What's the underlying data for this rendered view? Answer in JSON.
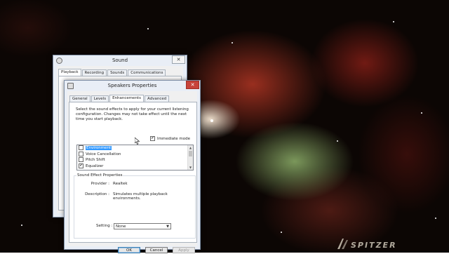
{
  "desktop": {
    "watermark": "SPITZER"
  },
  "sound_window": {
    "title": "Sound",
    "close_label": "✕",
    "tabs": [
      "Playback",
      "Recording",
      "Sounds",
      "Communications"
    ]
  },
  "speakers_window": {
    "title": "Speakers Properties",
    "close_label": "✕",
    "tabs": [
      "General",
      "Levels",
      "Enhancements",
      "Advanced"
    ],
    "active_tab": "Enhancements",
    "description": "Select the sound effects to apply for your current listening configuration. Changes may not take effect until the next time you start playback.",
    "immediate_mode": {
      "label": "Immediate mode",
      "checked": true
    },
    "effects": [
      {
        "label": "Environment",
        "checked": false,
        "selected": true
      },
      {
        "label": "Voice Cancellation",
        "checked": false,
        "selected": false
      },
      {
        "label": "Pitch Shift",
        "checked": false,
        "selected": false
      },
      {
        "label": "Equalizer",
        "checked": true,
        "selected": false
      }
    ],
    "properties": {
      "group_title": "Sound Effect Properties",
      "provider_label": "Provider :",
      "provider_value": "Realtek",
      "description_label": "Description :",
      "description_value": "Simulates multiple playback environments.",
      "setting_label": "Setting :",
      "setting_value": "None"
    },
    "buttons": {
      "ok": "OK",
      "cancel": "Cancel",
      "apply": "Apply"
    }
  },
  "colors": {
    "selection": "#3399ff",
    "titlebar": "#e9eef6",
    "close_active": "#c7433a"
  },
  "icons": [
    "speaker-icon",
    "close-icon",
    "checkmark-icon",
    "dropdown-arrow-icon",
    "mouse-pointer-icon"
  ]
}
